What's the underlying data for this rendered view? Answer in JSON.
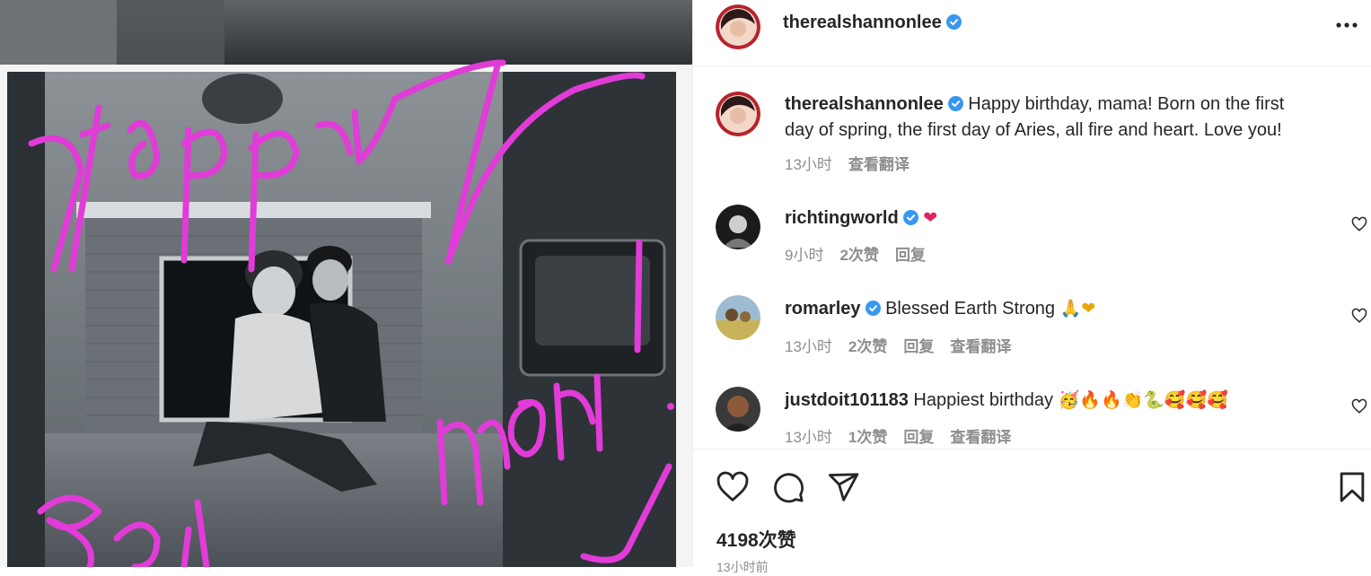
{
  "post": {
    "author": "therealshannonlee",
    "caption": "Happy birthday, mama! Born on the first day of spring, the first day of Aries, all fire and heart. Love you!",
    "caption_line1": "Happy birthday, mama! Born on the first",
    "caption_line2": "day of spring, the first day of Aries, all fire and heart. Love you!",
    "time": "13小时",
    "translate": "查看翻译",
    "likes": "4198次赞",
    "time_bottom": "13小时前"
  },
  "comments": [
    {
      "user": "richtingworld",
      "text": "",
      "emoji": "❤",
      "time": "9小时",
      "likes": "2次赞",
      "reply": "回复",
      "translate": ""
    },
    {
      "user": "romarley",
      "text": "Blessed Earth Strong",
      "emoji": "🙏❤",
      "time": "13小时",
      "likes": "2次赞",
      "reply": "回复",
      "translate": "查看翻译"
    },
    {
      "user": "justdoit101183",
      "text": "Happiest birthday",
      "emoji": "🥳🔥🔥👏🐍🥰🥰🥰",
      "time": "13小时",
      "likes": "1次赞",
      "reply": "回复",
      "translate": "查看翻译"
    }
  ],
  "photo": {
    "handwriting": [
      "Happy",
      "MOM",
      "Bday"
    ]
  },
  "colors": {
    "accent_blue": "#3897f0",
    "ink": "#e13bd8",
    "heart_red": "#ed2a3c"
  },
  "icons": {
    "more": "more-icon",
    "like": "heart-icon",
    "comment": "comment-icon",
    "share": "send-icon",
    "save": "bookmark-icon",
    "verified": "verified-badge-icon"
  }
}
